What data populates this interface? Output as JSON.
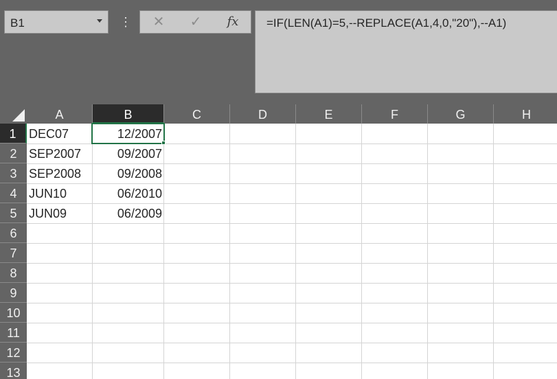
{
  "name_box": {
    "value": "B1"
  },
  "formula_bar": {
    "kebab": "⋮",
    "cancel_icon": "✕",
    "enter_icon": "✓",
    "fx_label": "fx",
    "formula": "=IF(LEN(A1)=5,--REPLACE(A1,4,0,\"20\"),--A1)"
  },
  "sheet": {
    "selected_cell": "B1",
    "columns": [
      "A",
      "B",
      "C",
      "D",
      "E",
      "F",
      "G",
      "H"
    ],
    "rows": [
      "1",
      "2",
      "3",
      "4",
      "5",
      "6",
      "7",
      "8",
      "9",
      "10",
      "11",
      "12",
      "13"
    ],
    "cells": [
      {
        "a": "DEC07",
        "b": "12/2007"
      },
      {
        "a": "SEP2007",
        "b": "09/2007"
      },
      {
        "a": "SEP2008",
        "b": "09/2008"
      },
      {
        "a": "JUN10",
        "b": "06/2010"
      },
      {
        "a": "JUN09",
        "b": "06/2009"
      }
    ]
  },
  "colors": {
    "accent": "#217346",
    "chrome": "#646464",
    "control": "#c9c9c9"
  }
}
